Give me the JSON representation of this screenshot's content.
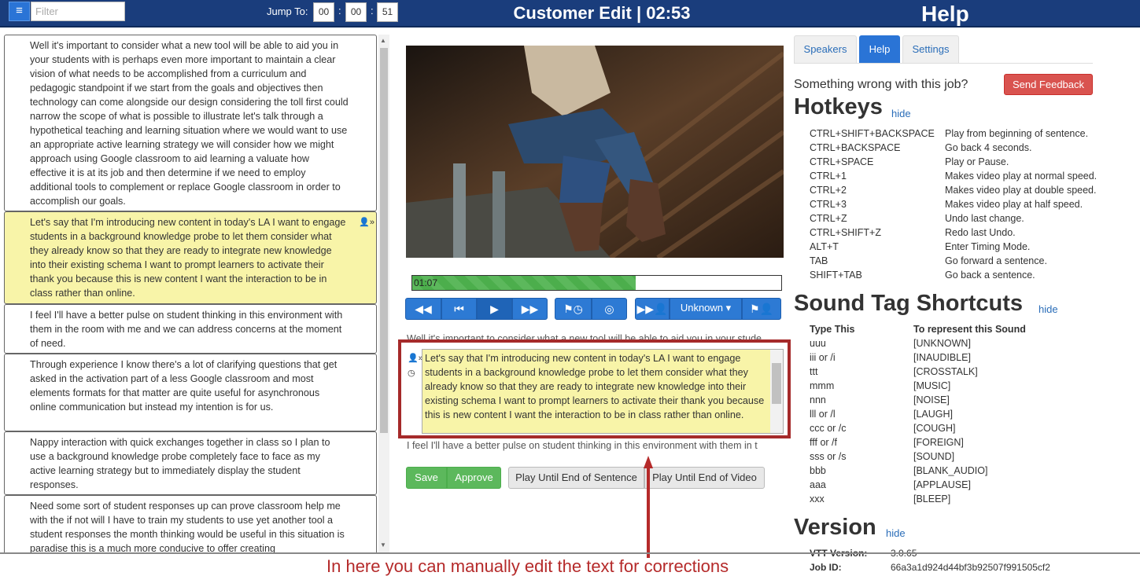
{
  "topbar": {
    "menu_icon": "≡",
    "filter_placeholder": "Filter",
    "jump_to_label": "Jump To:",
    "jump_hh": "00",
    "jump_mm": "00",
    "jump_ss": "51",
    "sep": ":",
    "title": "Customer Edit | 02:53",
    "help_title": "Help"
  },
  "segments": [
    {
      "text": "Well it's important to consider what a new tool will be able to aid you in your students with is perhaps even more important to maintain a clear vision of what needs to be accomplished from a curriculum and pedagogic standpoint if we start from the goals and objectives then technology can come alongside our design considering the toll first could narrow the scope of what is possible to illustrate let's talk through a hypothetical teaching and learning situation where we would want to use an appropriate active learning strategy we will consider how we might approach using Google classroom to aid learning a valuate how effective it is at its job and then determine if we need to employ additional tools to complement or replace Google classroom in order to accomplish our goals.",
      "active": false
    },
    {
      "text": "Let's say that I'm introducing new content in today's LA I want to engage students in a background knowledge probe to let them consider what they already know so that they are ready to integrate new knowledge into their existing schema I want to prompt learners to activate their thank you because this is new content I want the interaction to be in class rather than online.",
      "active": true
    },
    {
      "text": "I feel I'll have a better pulse on student thinking in this environment with them in the room with me and we can address concerns at the moment of need.",
      "active": false
    },
    {
      "text": "Through experience I know there's a lot of clarifying questions that get asked in the activation part of a less Google classroom and most elements formats for that matter are quite useful for asynchronous online communication but instead my intention is for us.",
      "active": false
    },
    {
      "text": "Nappy interaction with quick exchanges together in class so I plan to use a background knowledge probe completely face to face as my active learning strategy but to immediately display the student responses.",
      "active": false
    },
    {
      "text": "Need some sort of student responses up can prove classroom help me with the if not will I have to train my students to use yet another tool a student responses the month thinking would be useful in this situation is paradise this is a much more conducive to offer creating",
      "active": false
    }
  ],
  "player": {
    "progress_label": "01:07",
    "progress_fraction": 0.606,
    "speaker_dropdown": "Unknown ▾"
  },
  "editor": {
    "prev_context": "Well it's important to consider what a new tool will be able to aid you in your stude",
    "text": "Let's say that I'm introducing new content in today's LA I want to engage students in a background knowledge probe to let them consider what they already know so that they are ready to integrate new knowledge into their existing schema I want to prompt learners to activate their thank you because this is new content I want the interaction to be in class rather than online.",
    "next_context": "I feel I'll have a better pulse on student thinking in this environment with them in t"
  },
  "actions": {
    "save": "Save",
    "approve": "Approve",
    "play_sentence": "Play Until End of Sentence",
    "play_video": "Play Until End of Video"
  },
  "annotation": "In here you can manually edit the text for corrections",
  "help": {
    "tabs": [
      "Speakers",
      "Help",
      "Settings"
    ],
    "wrong_text": "Something wrong with this job?",
    "feedback_button": "Send Feedback",
    "hotkeys_title": "Hotkeys",
    "hide_label": "hide",
    "hotkeys": [
      {
        "key": "CTRL+SHIFT+BACKSPACE",
        "desc": "Play from beginning of sentence."
      },
      {
        "key": "CTRL+BACKSPACE",
        "desc": "Go back 4 seconds."
      },
      {
        "key": "CTRL+SPACE",
        "desc": "Play or Pause."
      },
      {
        "key": "CTRL+1",
        "desc": "Makes video play at normal speed."
      },
      {
        "key": "CTRL+2",
        "desc": "Makes video play at double speed."
      },
      {
        "key": "CTRL+3",
        "desc": "Makes video play at half speed."
      },
      {
        "key": "CTRL+Z",
        "desc": "Undo last change."
      },
      {
        "key": "CTRL+SHIFT+Z",
        "desc": "Redo last Undo."
      },
      {
        "key": "ALT+T",
        "desc": "Enter Timing Mode."
      },
      {
        "key": "TAB",
        "desc": "Go forward a sentence."
      },
      {
        "key": "SHIFT+TAB",
        "desc": "Go back a sentence."
      }
    ],
    "sound_title": "Sound Tag Shortcuts",
    "sound_col1": "Type This",
    "sound_col2": "To represent this Sound",
    "sounds": [
      {
        "type": "uuu",
        "tag": "[UNKNOWN]"
      },
      {
        "type": "iii or /i",
        "tag": "[INAUDIBLE]"
      },
      {
        "type": "ttt",
        "tag": "[CROSSTALK]"
      },
      {
        "type": "mmm",
        "tag": "[MUSIC]"
      },
      {
        "type": "nnn",
        "tag": "[NOISE]"
      },
      {
        "type": "lll or /l",
        "tag": "[LAUGH]"
      },
      {
        "type": "ccc or /c",
        "tag": "[COUGH]"
      },
      {
        "type": "fff or /f",
        "tag": "[FOREIGN]"
      },
      {
        "type": "sss or /s",
        "tag": "[SOUND]"
      },
      {
        "type": "bbb",
        "tag": "[BLANK_AUDIO]"
      },
      {
        "type": "aaa",
        "tag": "[APPLAUSE]"
      },
      {
        "type": "xxx",
        "tag": "[BLEEP]"
      }
    ],
    "version_title": "Version",
    "vtt_label": "VTT Version:",
    "vtt_value": "3.0.65",
    "job_label": "Job ID:",
    "job_value": "66a3a1d924d44bf3b92507f991505cf2"
  }
}
